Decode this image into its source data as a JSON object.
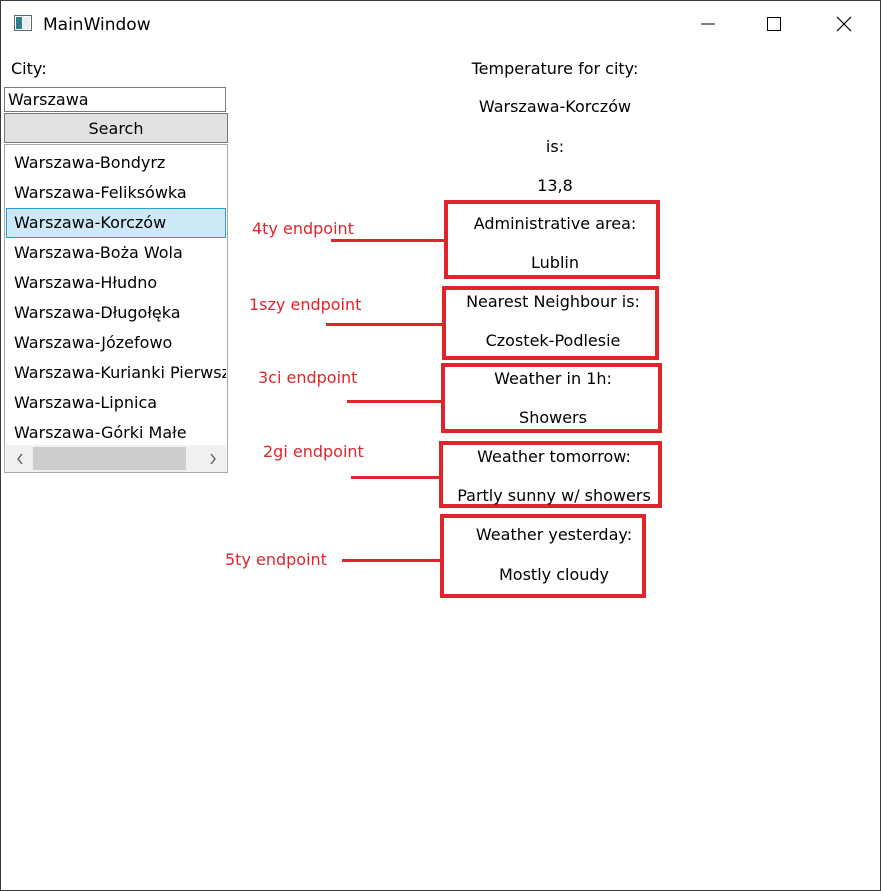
{
  "window": {
    "title": "MainWindow"
  },
  "icons": {
    "app": "app-window-icon",
    "minimize": "minimize-icon",
    "maximize": "maximize-icon",
    "close": "close-icon",
    "scroll_left": "chevron-left-icon",
    "scroll_right": "chevron-right-icon"
  },
  "colors": {
    "annotation": "#e0242b",
    "selection_bg": "#cde8f7",
    "selection_border": "#26a0da"
  },
  "form": {
    "city_label": "City:",
    "city_value": "Warszawa",
    "search_label": "Search"
  },
  "results": {
    "items": [
      "Warszawa-Bondyrz",
      "Warszawa-Feliksówka",
      "Warszawa-Korczów",
      "Warszawa-Boża Wola",
      "Warszawa-Hłudno",
      "Warszawa-Długołęka",
      "Warszawa-Józefowo",
      "Warszawa-Kurianki Pierwsze",
      "Warszawa-Lipnica",
      "Warszawa-Górki Małe"
    ],
    "selected_index": 2
  },
  "weather": {
    "temp_heading": "Temperature for city:",
    "city": "Warszawa-Korczów",
    "is_label": "is:",
    "temperature": "13,8",
    "admin_label": "Administrative area:",
    "admin_value": "Lublin",
    "neighbour_label": "Nearest Neighbour is:",
    "neighbour_value": "Czostek-Podlesie",
    "hour_label": "Weather in 1h:",
    "hour_value": "Showers",
    "tomorrow_label": "Weather tomorrow:",
    "tomorrow_value": "Partly sunny w/ showers",
    "yesterday_label": "Weather yesterday:",
    "yesterday_value": "Mostly cloudy"
  },
  "annotations": {
    "admin": "4ty endpoint",
    "neighbour": "1szy endpoint",
    "hour": "3ci endpoint",
    "tomorrow": "2gi endpoint",
    "yesterday": "5ty endpoint"
  }
}
